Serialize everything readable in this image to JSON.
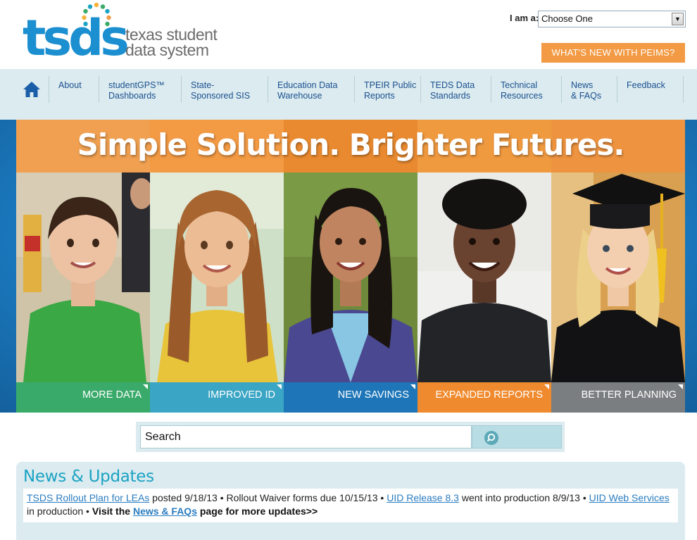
{
  "header": {
    "logo_text": "tsds",
    "logo_tagline_line1": "texas student",
    "logo_tagline_line2": "data system",
    "iam_label": "I am a:",
    "iam_selected": "Choose One",
    "peims_button": "WHAT'S NEW WITH PEIMS?"
  },
  "nav": {
    "home_icon": "home-icon",
    "items": [
      {
        "label": "About"
      },
      {
        "label": "studentGPS™\nDashboards"
      },
      {
        "label": "State-\nSponsored SIS"
      },
      {
        "label": "Education Data\nWarehouse"
      },
      {
        "label": "TPEIR Public\nReports"
      },
      {
        "label": "TEDS Data\nStandards"
      },
      {
        "label": "Technical\nResources"
      },
      {
        "label": "News\n& FAQs"
      },
      {
        "label": "Feedback"
      }
    ]
  },
  "hero": {
    "title": "Simple Solution. Brighter Futures.",
    "tiles": [
      {
        "label": "MORE DATA",
        "color": "#3aaa6a"
      },
      {
        "label": "IMPROVED ID",
        "color": "#3aa5c4"
      },
      {
        "label": "NEW SAVINGS",
        "color": "#1e76b8"
      },
      {
        "label": "EXPANDED REPORTS",
        "color": "#f08a2e"
      },
      {
        "label": "BETTER PLANNING",
        "color": "#7b7e80"
      }
    ]
  },
  "search": {
    "placeholder": "Search",
    "button_icon": "search-icon"
  },
  "news": {
    "title": "News & Updates",
    "link1": "TSDS Rollout Plan for LEAs",
    "text1": " posted 9/18/13 • Rollout Waiver forms due 10/15/13 • ",
    "link2": "UID Release 8.3",
    "text2": " went into production 8/9/13 • ",
    "link3": "UID Web Services",
    "text3": " in production • ",
    "visit_prefix": "Visit the ",
    "visit_link": "News & FAQs",
    "visit_suffix": " page for more updates>>"
  },
  "colors": {
    "brand_blue": "#1b8fd0",
    "brand_orange": "#f39a44",
    "nav_bg": "#dbebef",
    "news_title": "#1ca3c4"
  }
}
